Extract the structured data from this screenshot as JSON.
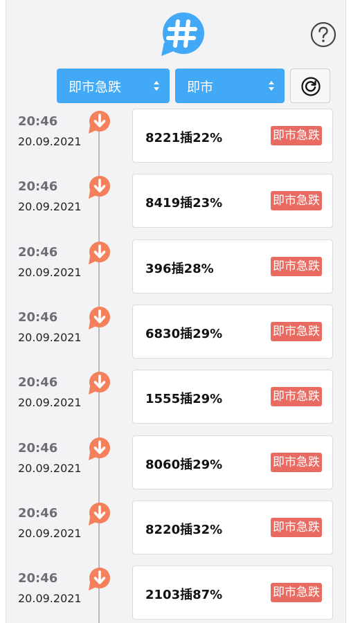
{
  "header": {
    "logo_icon": "hashtag-chat-bubble-icon",
    "help_icon": "question-circle-icon",
    "refresh_icon": "refresh-icon"
  },
  "filters": {
    "type_select": {
      "value": "即市急跌",
      "icon": "sort-caret-icon"
    },
    "period_select": {
      "value": "即市",
      "icon": "sort-caret-icon"
    }
  },
  "colors": {
    "accent": "#42a9f6",
    "alert": "#e96a60"
  },
  "alerts": [
    {
      "time": "20:46",
      "date": "20.09.2021",
      "text": "8221插22%",
      "badge": "即市急跌"
    },
    {
      "time": "20:46",
      "date": "20.09.2021",
      "text": "8419插23%",
      "badge": "即市急跌"
    },
    {
      "time": "20:46",
      "date": "20.09.2021",
      "text": "396插28%",
      "badge": "即市急跌"
    },
    {
      "time": "20:46",
      "date": "20.09.2021",
      "text": "6830插29%",
      "badge": "即市急跌"
    },
    {
      "time": "20:46",
      "date": "20.09.2021",
      "text": "1555插29%",
      "badge": "即市急跌"
    },
    {
      "time": "20:46",
      "date": "20.09.2021",
      "text": "8060插29%",
      "badge": "即市急跌"
    },
    {
      "time": "20:46",
      "date": "20.09.2021",
      "text": "8220插32%",
      "badge": "即市急跌"
    },
    {
      "time": "20:46",
      "date": "20.09.2021",
      "text": "2103插87%",
      "badge": "即市急跌"
    }
  ]
}
